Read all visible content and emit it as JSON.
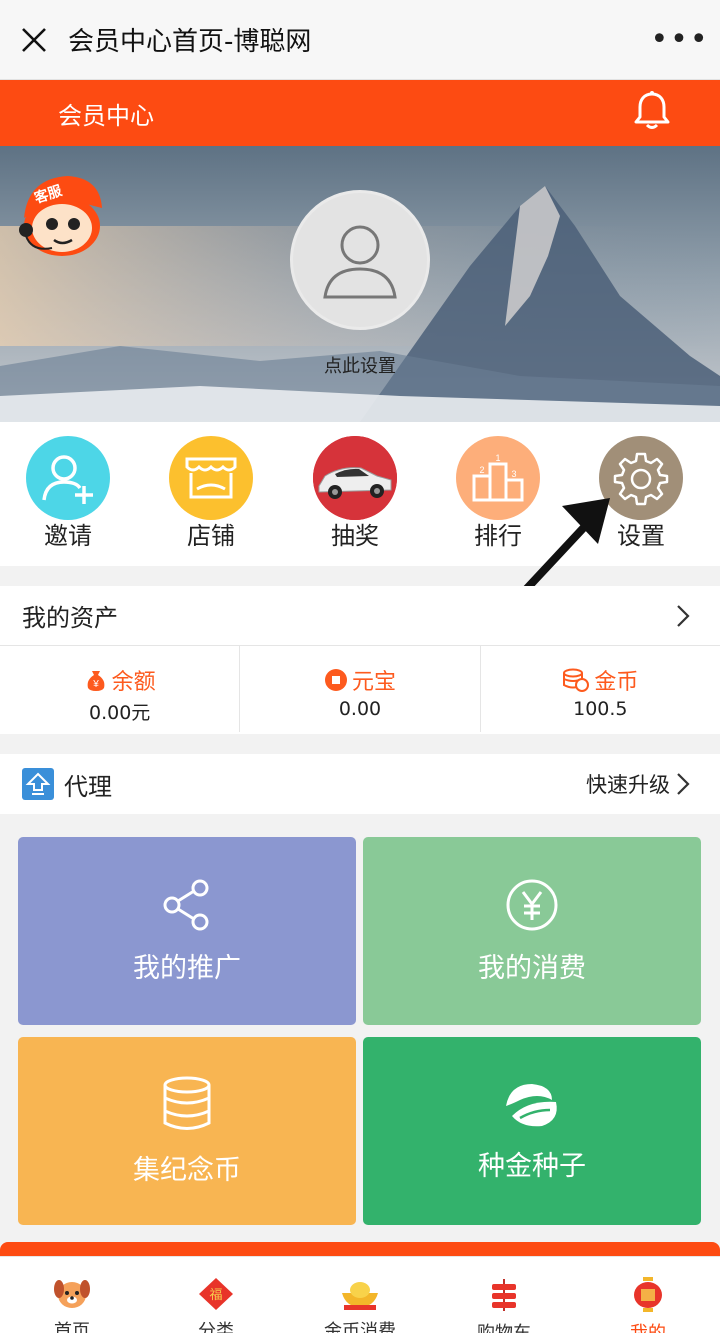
{
  "topbar": {
    "title": "会员中心首页-博聪网",
    "more": "•••"
  },
  "header": {
    "title": "会员中心"
  },
  "hero": {
    "avatar_label": "点此设置",
    "kefu_label": "客服"
  },
  "quick": [
    {
      "label": "邀请",
      "icon": "invite-icon",
      "color": "#4dd6e7"
    },
    {
      "label": "店铺",
      "icon": "shop-icon",
      "color": "#fcc02e"
    },
    {
      "label": "抽奖",
      "icon": "car-icon",
      "color": "#d6333a"
    },
    {
      "label": "排行",
      "icon": "podium-icon",
      "color": "#fdae7a"
    },
    {
      "label": "设置",
      "icon": "gear-icon",
      "color": "#a18f78"
    }
  ],
  "assets": {
    "title": "我的资产",
    "items": [
      {
        "name": "余额",
        "value": "0.00元"
      },
      {
        "name": "元宝",
        "value": "0.00"
      },
      {
        "name": "金币",
        "value": "100.5"
      }
    ]
  },
  "agent": {
    "title": "代理",
    "upgrade": "快速升级"
  },
  "tiles": [
    {
      "label": "我的推广",
      "color": "#8b97d0"
    },
    {
      "label": "我的消费",
      "color": "#89c997"
    },
    {
      "label": "集纪念币",
      "color": "#f8b552"
    },
    {
      "label": "种金种子",
      "color": "#33b26c"
    }
  ],
  "nav": [
    {
      "label": "首页"
    },
    {
      "label": "分类"
    },
    {
      "label": "金币消费"
    },
    {
      "label": "购物车"
    },
    {
      "label": "我的"
    }
  ],
  "colors": {
    "brand": "#fd4b12",
    "accent": "#fd5a1e"
  }
}
